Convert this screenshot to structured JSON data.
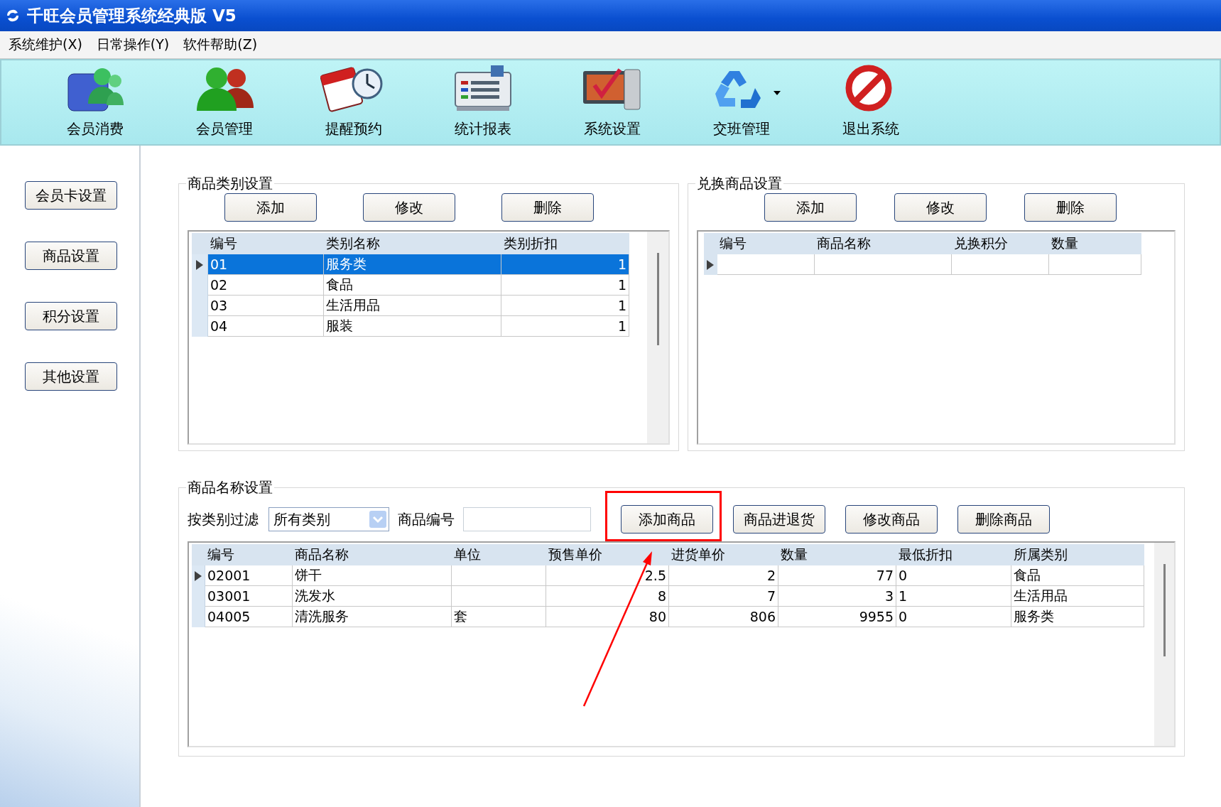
{
  "window": {
    "title": "千旺会员管理系统经典版 V5"
  },
  "menu": [
    "系统维护(X)",
    "日常操作(Y)",
    "软件帮助(Z)"
  ],
  "toolbar": [
    {
      "label": "会员消费",
      "dropdown": false
    },
    {
      "label": "会员管理",
      "dropdown": false
    },
    {
      "label": "提醒预约",
      "dropdown": false
    },
    {
      "label": "统计报表",
      "dropdown": false
    },
    {
      "label": "系统设置",
      "dropdown": false
    },
    {
      "label": "交班管理",
      "dropdown": true
    },
    {
      "label": "退出系统",
      "dropdown": false
    }
  ],
  "sidebar": [
    "会员卡设置",
    "商品设置",
    "积分设置",
    "其他设置"
  ],
  "category_group": {
    "title": "商品类别设置",
    "buttons": [
      "添加",
      "修改",
      "删除"
    ],
    "table": {
      "columns": [
        "编号",
        "类别名称",
        "类别折扣"
      ],
      "rows": [
        {
          "cells": [
            "01",
            "服务类",
            "1"
          ],
          "selected": true,
          "current": true
        },
        {
          "cells": [
            "02",
            "食品",
            "1"
          ],
          "selected": false,
          "current": false
        },
        {
          "cells": [
            "03",
            "生活用品",
            "1"
          ],
          "selected": false,
          "current": false
        },
        {
          "cells": [
            "04",
            "服装",
            "1"
          ],
          "selected": false,
          "current": false
        }
      ]
    }
  },
  "exchange_group": {
    "title": "兑换商品设置",
    "buttons": [
      "添加",
      "修改",
      "删除"
    ],
    "table": {
      "columns": [
        "编号",
        "商品名称",
        "兑换积分",
        "数量"
      ],
      "new_row": true
    }
  },
  "product_group": {
    "title": "商品名称设置",
    "filter_label": "按类别过滤",
    "filter_value": "所有类别",
    "code_label": "商品编号",
    "buttons": [
      {
        "label": "添加商品",
        "highlighted": true
      },
      {
        "label": "商品进退货",
        "highlighted": false
      },
      {
        "label": "修改商品",
        "highlighted": false
      },
      {
        "label": "删除商品",
        "highlighted": false
      }
    ],
    "table": {
      "columns": [
        "编号",
        "商品名称",
        "单位",
        "预售单价",
        "进货单价",
        "数量",
        "最低折扣",
        "所属类别"
      ],
      "rows": [
        {
          "cells": [
            "02001",
            "饼干",
            null,
            "2.5",
            "2",
            "77",
            "0",
            "食品"
          ],
          "selected": false,
          "current": true
        },
        {
          "cells": [
            "03001",
            "洗发水",
            null,
            "8",
            "7",
            "3",
            "1",
            "生活用品"
          ],
          "selected": false,
          "current": false
        },
        {
          "cells": [
            "04005",
            "清洗服务",
            "套",
            "80",
            "806",
            "9955",
            "0",
            "服务类"
          ],
          "selected": false,
          "current": false
        }
      ]
    }
  }
}
